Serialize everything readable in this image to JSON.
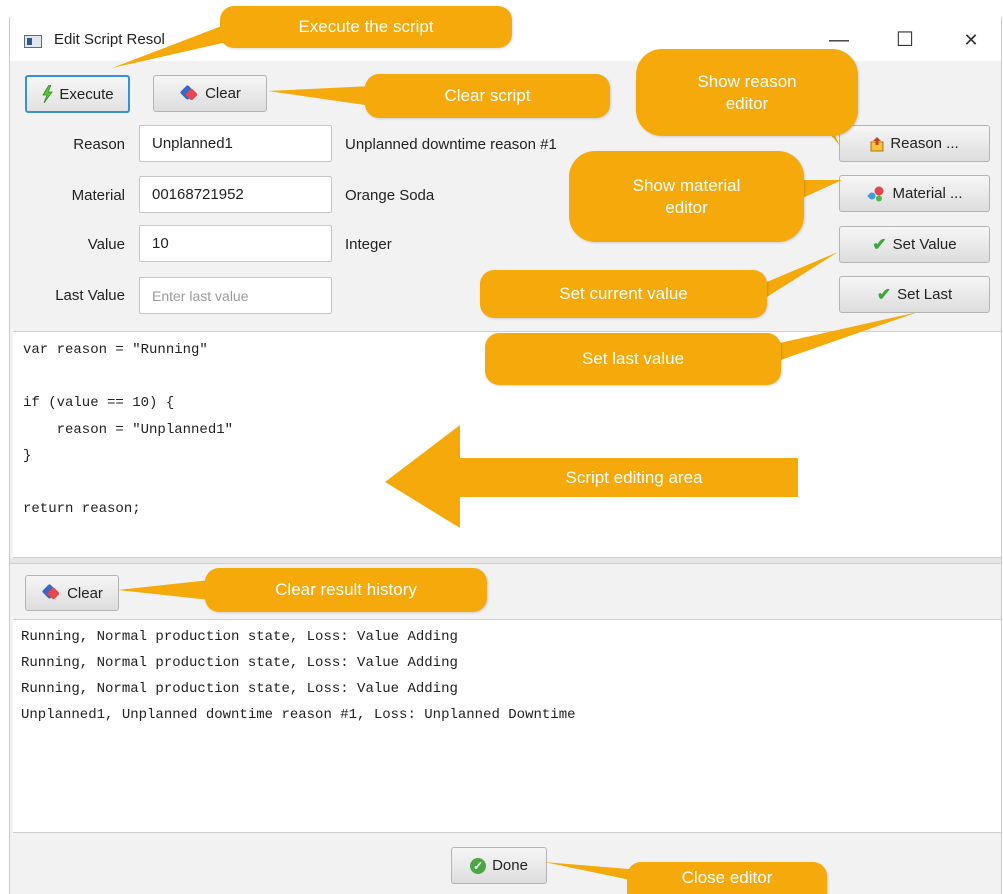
{
  "window": {
    "title": "Edit Script Resol",
    "minimize_glyph": "—",
    "maximize_glyph": "☐",
    "close_glyph": "✕"
  },
  "toolbar": {
    "execute_label": "Execute",
    "clear_label": "Clear"
  },
  "form": {
    "reason": {
      "label": "Reason",
      "value": "Unplanned1",
      "description": "Unplanned downtime reason #1"
    },
    "material": {
      "label": "Material",
      "value": "00168721952",
      "description": "Orange Soda"
    },
    "value": {
      "label": "Value",
      "value": "10",
      "description": "Integer"
    },
    "last_value": {
      "label": "Last Value",
      "value": "",
      "placeholder": "Enter last value"
    }
  },
  "side_buttons": {
    "reason_label": "Reason ...",
    "material_label": "Material ...",
    "set_value_label": "Set Value",
    "set_last_label": "Set Last"
  },
  "script": {
    "lines": [
      "var reason = \"Running\"",
      "",
      "if (value == 10) {",
      "    reason = \"Unplanned1\"",
      "}",
      "",
      "return reason;"
    ]
  },
  "results": {
    "clear_label": "Clear",
    "lines": [
      "Running, Normal production state, Loss: Value Adding",
      "Running, Normal production state, Loss: Value Adding",
      "Running, Normal production state, Loss: Value Adding",
      "Unplanned1, Unplanned downtime reason #1, Loss: Unplanned Downtime"
    ]
  },
  "footer": {
    "done_label": "Done"
  },
  "callouts": {
    "execute": "Execute the script",
    "clear_script": "Clear script",
    "reason_editor": "Show reason\neditor",
    "material_editor": "Show material\neditor",
    "set_current": "Set current value",
    "set_last": "Set last value",
    "script_area": "Script editing area",
    "clear_history": "Clear result history",
    "close_editor": "Close editor"
  },
  "colors": {
    "callout": "#f5a90a",
    "focus_border": "#3b8fd6",
    "check_green": "#3ba63b"
  }
}
